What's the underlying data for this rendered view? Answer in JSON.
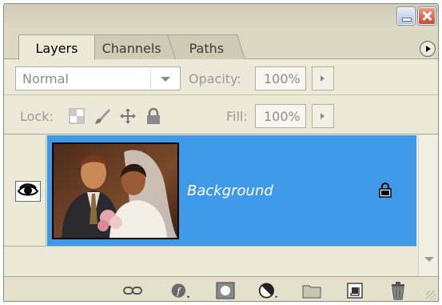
{
  "window": {
    "minimize_icon": "minimize-icon",
    "close_icon": "close-icon"
  },
  "tabs": [
    {
      "label": "Layers",
      "active": true
    },
    {
      "label": "Channels",
      "active": false
    },
    {
      "label": "Paths",
      "active": false
    }
  ],
  "panel_menu_icon": "triangle-right-icon",
  "blend": {
    "mode": "Normal",
    "opacity_label": "Opacity:",
    "opacity_value": "100%"
  },
  "lock": {
    "label": "Lock:",
    "icons": [
      "lock-transparency-icon",
      "lock-brush-icon",
      "lock-move-icon",
      "lock-all-icon"
    ],
    "fill_label": "Fill:",
    "fill_value": "100%"
  },
  "layers": [
    {
      "name": "Background",
      "visible": true,
      "selected": true,
      "locked": true,
      "thumbnail": "wedding-photo-thumbnail"
    }
  ],
  "bottom_icons": [
    "link-icon",
    "layer-style-icon",
    "layer-mask-icon",
    "adjustment-layer-icon",
    "new-group-icon",
    "new-layer-icon",
    "trash-icon"
  ],
  "colors": {
    "selection": "#3e9ae8",
    "panel": "#ece9d8"
  }
}
